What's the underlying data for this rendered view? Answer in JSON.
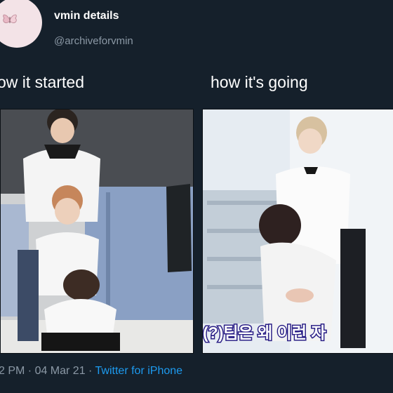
{
  "tweet": {
    "display_name": "vmin details",
    "handle": "@archiveforvmin",
    "avatar_icon": "butterfly-icon",
    "caption_left": "ow it started",
    "caption_right": "how it's going",
    "meta_time_date": "2 PM · 04 Mar 21 ·",
    "meta_app": "Twitter for iPhone"
  },
  "photos": {
    "left_alt": "",
    "right_subtitle_part1": "(?)팀은",
    "right_subtitle_part2": "왜 이런 자"
  },
  "colors": {
    "background": "#15202b",
    "secondary_text": "#8b98a5",
    "link": "#1d9bf0",
    "subtitle_outline": "#2a1f86"
  }
}
